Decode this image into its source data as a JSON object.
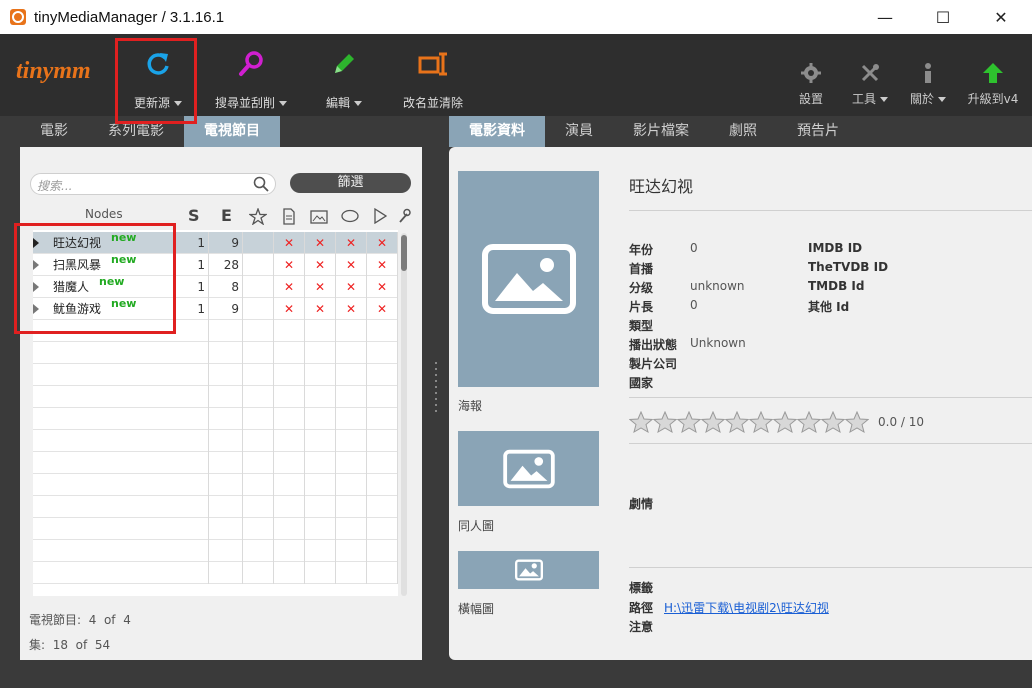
{
  "window": {
    "title": "tinyMediaManager / 3.1.16.1",
    "minimize": "—",
    "maximize": "☐",
    "close": "✕"
  },
  "toolbar": {
    "logo": "tinymm",
    "update_source": "更新源",
    "search_scrape": "搜尋並刮削",
    "edit": "編輯",
    "rename_clean": "改名並清除",
    "settings": "設置",
    "tools": "工具",
    "about": "關於",
    "upgrade": "升級到v4"
  },
  "colors": {
    "accent": "#e8731a",
    "tab_active": "#8aa4b6",
    "new_badge": "#22aa22",
    "highlight": "#e02020"
  },
  "left_tabs": [
    "電影",
    "系列電影",
    "電視節目"
  ],
  "right_tabs": [
    "電影資料",
    "演員",
    "影片檔案",
    "劇照",
    "預告片"
  ],
  "search": {
    "placeholder": "搜索...",
    "filter_label": "篩選"
  },
  "grid": {
    "headers": {
      "nodes": "Nodes",
      "s": "S",
      "e": "E"
    },
    "rows": [
      {
        "name": "旺达幻视",
        "badge": "new",
        "s": "1",
        "e": "9",
        "x": [
          "✕",
          "✕",
          "✕",
          "✕"
        ]
      },
      {
        "name": "扫黑风暴",
        "badge": "new",
        "s": "1",
        "e": "28",
        "x": [
          "✕",
          "✕",
          "✕",
          "✕"
        ]
      },
      {
        "name": "猎魔人",
        "badge": "new",
        "s": "1",
        "e": "8",
        "x": [
          "✕",
          "✕",
          "✕",
          "✕"
        ]
      },
      {
        "name": "鱿鱼游戏",
        "badge": "new",
        "s": "1",
        "e": "9",
        "x": [
          "✕",
          "✕",
          "✕",
          "✕"
        ]
      }
    ]
  },
  "stats": {
    "tv_label": "電視節目:",
    "tv_count": "4",
    "of1": "of",
    "tv_total": "4",
    "ep_label": "集:",
    "ep_count": "18",
    "of2": "of",
    "ep_total": "54"
  },
  "detail": {
    "title": "旺达幻视",
    "poster_label": "海報",
    "fanart_label": "同人圖",
    "banner_label": "橫幅圖",
    "fields": {
      "year_label": "年份",
      "year": "0",
      "premiered_label": "首播",
      "cert_label": "分级",
      "cert": "unknown",
      "runtime_label": "片長",
      "runtime": "0",
      "genre_label": "類型",
      "status_label": "播出狀態",
      "status": "Unknown",
      "studio_label": "製片公司",
      "country_label": "國家",
      "imdb_label": "IMDB ID",
      "tvdb_label": "TheTVDB ID",
      "tmdb_label": "TMDB Id",
      "other_label": "其他 Id"
    },
    "rating": "0.0 / 10",
    "rating_stars": 10,
    "plot_label": "劇情",
    "tags_label": "標籤",
    "path_label": "路徑",
    "path": "H:\\迅雷下载\\电视剧2\\旺达幻视",
    "note_label": "注意"
  }
}
